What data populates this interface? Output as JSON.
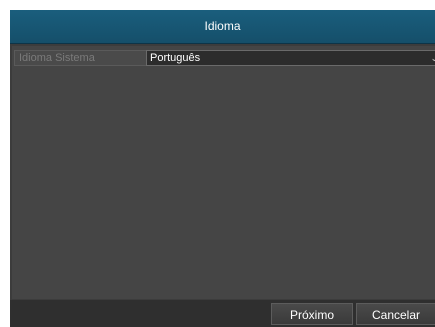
{
  "window": {
    "title": "Idioma"
  },
  "settings": {
    "language_label": "Idioma Sistema",
    "language_value": "Português"
  },
  "footer": {
    "next_label": "Próximo",
    "cancel_label": "Cancelar"
  },
  "icons": {
    "dropdown": "chevron-down-icon"
  }
}
